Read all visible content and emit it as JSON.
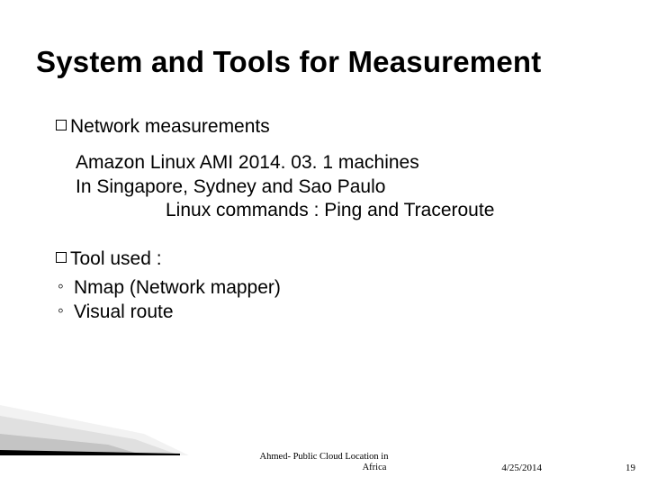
{
  "title": "System and Tools for Measurement",
  "sections": [
    {
      "heading_prefix": "Network",
      "heading_rest": " measurements",
      "lines": [
        "Amazon Linux AMI 2014. 03. 1 machines",
        "In  Singapore, Sydney and Sao Paulo",
        "Linux commands : Ping and Traceroute"
      ]
    },
    {
      "heading_prefix": "Tool",
      "heading_rest": " used :",
      "subitems": [
        "Nmap (Network mapper)",
        "Visual route"
      ]
    }
  ],
  "footer": {
    "center_line1": "Ahmed- Public Cloud Location in",
    "center_line2": "Africa",
    "date": "4/25/2014",
    "page": "19"
  }
}
